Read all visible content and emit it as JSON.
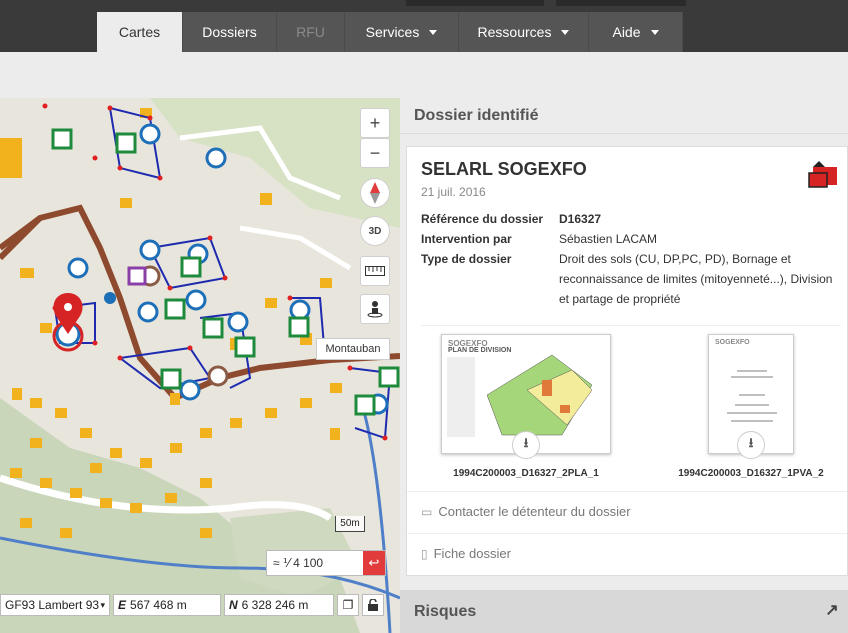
{
  "nav": {
    "tabs": [
      {
        "label": "Cartes"
      },
      {
        "label": "Dossiers"
      },
      {
        "label": "RFU"
      },
      {
        "label": "Services"
      },
      {
        "label": "Ressources"
      },
      {
        "label": "Aide"
      }
    ]
  },
  "map": {
    "zoom_in": "+",
    "zoom_out": "−",
    "btn_3d": "3D",
    "tooltip": "Montauban",
    "scale_label": "50m",
    "scale_value": "≈ ⅟ 4 100",
    "go_symbol": "↩",
    "projection": "GF93 Lambert 93",
    "east_label": "E",
    "east_value": "567 468 m",
    "north_label": "N",
    "north_value": "6 328 246 m"
  },
  "panel": {
    "header": "Dossier identifié",
    "title": "SELARL SOGEXFO",
    "date": "21 juil. 2016",
    "fields": [
      {
        "label": "Référence du dossier",
        "value": "D16327"
      },
      {
        "label": "Intervention par",
        "value": "Sébastien LACAM"
      },
      {
        "label": "Type de dossier",
        "value": "Droit des sols (CU, DP,PC, PD), Bornage et reconnaissance de limites (mitoyenneté...), Division et partage de propriété"
      }
    ],
    "documents": [
      {
        "name": "1994C200003_D16327_2PLA_1",
        "brand": "SOGEXFO",
        "subtitle": "PLAN DE DIVISION"
      },
      {
        "name": "1994C200003_D16327_1PVA_2",
        "brand": "SOGEXFO",
        "subtitle": ""
      }
    ],
    "contact": "Contacter le détenteur du dossier",
    "fiche": "Fiche dossier",
    "risques": "Risques"
  },
  "colors": {
    "accent": "#e23b3b",
    "nav_bg": "#555555",
    "panel_bg": "#ececec"
  }
}
